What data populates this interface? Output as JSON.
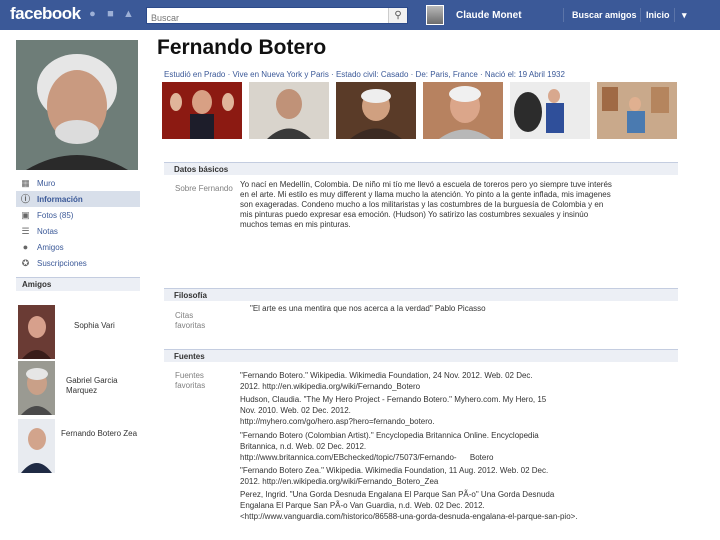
{
  "topbar": {
    "logo": "facebook",
    "search_placeholder": "Buscar",
    "user_name": "Claude Monet",
    "find_friends": "Buscar amigos",
    "home": "Inicio",
    "menu_arrow": "▾"
  },
  "profile": {
    "name": "Fernando Botero",
    "info_line": "Estudió en Prado · Vive en Nueva York y Paris · Estado civil: Casado · De: Paris, France · Nació el: 19 Abril 1932"
  },
  "left_nav": {
    "items": [
      {
        "label": "Muro",
        "icon": "wall-icon"
      },
      {
        "label": "Información",
        "icon": "info-icon"
      },
      {
        "label": "Fotos (85)",
        "icon": "photos-icon"
      },
      {
        "label": "Notas",
        "icon": "notes-icon"
      },
      {
        "label": "Amigos",
        "icon": "friends-icon"
      },
      {
        "label": "Suscripciones",
        "icon": "subscriptions-icon"
      }
    ]
  },
  "friends": {
    "header": "Amigos",
    "list": [
      {
        "name": "Sophia Vari"
      },
      {
        "name_line1": "Gabriel Garcia",
        "name_line2": "Marquez"
      },
      {
        "name": "Fernando Botero Zea"
      }
    ]
  },
  "basic_info": {
    "header": "Datos básicos",
    "about_label": "Sobre Fernando",
    "about_lines": [
      "Yo nací en  Medellín, Colombia. De niño mi tío me llevó a escuela de toreros pero yo siempre tuve interés",
      "en el arte. Mi estilo es muy different y llama mucho la atención. Yo pinto a la gente inflada, mis imagenes",
      "son exageradas. Condeno mucho a los militaristas y las costumbres de la burguesía de Colombia y en",
      "mis pinturas puedo expresar esa emoción. (Hudson) Yo satirizo las costumbres sexuales y insinúo",
      "muchos temas en mis pinturas."
    ]
  },
  "philosophy": {
    "header": "Filosofía",
    "label_line1": "Citas",
    "label_line2": "favoritas",
    "quote": "\"El arte es una mentira que nos acerca a la verdad\" Pablo Picasso"
  },
  "sources": {
    "header": "Fuentes",
    "label_line1": "Fuentes",
    "label_line2": "favoritas",
    "lines": [
      "\"Fernando Botero.\" Wikipedia. Wikimedia Foundation, 24 Nov. 2012. Web. 02 Dec.",
      "2012. http://en.wikipedia.org/wiki/Fernando_Botero",
      "Hudson, Claudia. \"The My Hero Project - Fernando Botero.\" Myhero.com. My Hero, 15",
      "Nov. 2010. Web. 02 Dec. 2012.",
      "http://myhero.com/go/hero.asp?hero=fernando_botero.",
      "\"Fernando Botero (Colombian Artist).\" Encyclopedia Britannica Online. Encyclopedia",
      "Britannica, n.d. Web. 02 Dec. 2012.",
      "http://www.britannica.com/EBchecked/topic/75073/Fernando-      Botero",
      "\"Fernando Botero Zea.\" Wikipedia. Wikimedia Foundation, 11 Aug. 2012. Web. 02 Dec.",
      "2012. http://en.wikipedia.org/wiki/Fernando_Botero_Zea",
      "Perez, Ingrid. \"Una Gorda Desnuda Engalana El Parque San PÃ-o\" Una Gorda Desnuda",
      "Engalana El Parque San PÃ-o Van Guardia, n.d. Web. 02 Dec. 2012.",
      "<http://www.vanguardia.com/historico/86588-una-gorda-desnuda-engalana-el-parque-san-pio>."
    ]
  }
}
